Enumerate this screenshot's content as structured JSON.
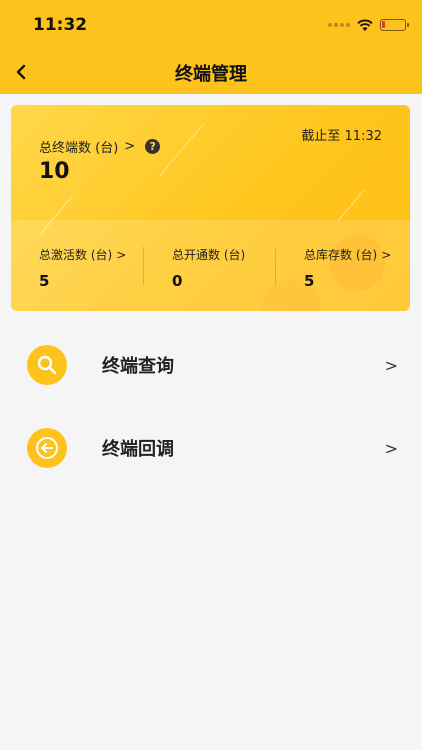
{
  "status_bar": {
    "time": "11:32"
  },
  "header": {
    "title": "终端管理"
  },
  "summary": {
    "total_label": "总终端数 (台)",
    "total_value": "10",
    "as_of": "截止至 11:32",
    "stats": [
      {
        "label": "总激活数 (台)",
        "value": "5"
      },
      {
        "label": "总开通数 (台)",
        "value": "0"
      },
      {
        "label": "总库存数 (台)",
        "value": "5"
      }
    ]
  },
  "menu": [
    {
      "label": "终端查询",
      "icon": "search-icon"
    },
    {
      "label": "终端回调",
      "icon": "return-icon"
    }
  ],
  "colors": {
    "accent": "#fec21d",
    "background": "#f5f5f5"
  }
}
